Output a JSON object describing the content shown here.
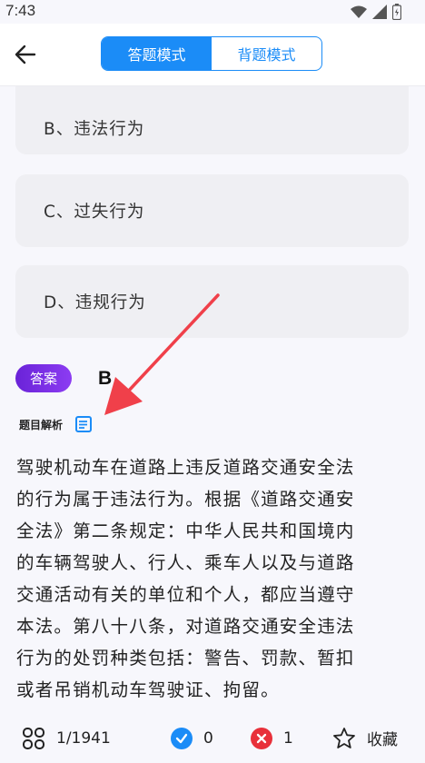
{
  "status": {
    "time": "7:43"
  },
  "header": {
    "tabs": [
      {
        "label": "答题模式",
        "active": true
      },
      {
        "label": "背题模式",
        "active": false
      }
    ]
  },
  "options": [
    {
      "label": "B、违法行为"
    },
    {
      "label": "C、过失行为"
    },
    {
      "label": "D、违规行为"
    }
  ],
  "answer": {
    "badge": "答案",
    "value": "B"
  },
  "analysis": {
    "title": "题目解析",
    "lines": [
      "驾驶机动车在道路上违反道路交通安全法",
      "的行为属于违法行为。根据《道路交通安",
      "全法》第二条规定：中华人民共和国境内",
      "的车辆驾驶人、行人、乘车人以及与道路",
      "交通活动有关的单位和个人，都应当遵守",
      "本法。第八十八条，对道路交通安全违法",
      "行为的处罚种类包括：警告、罚款、暂扣",
      "或者吊销机动车驾驶证、拘留。"
    ]
  },
  "bottom": {
    "progress": "1/1941",
    "correct": "0",
    "wrong": "1",
    "favorite_label": "收藏"
  },
  "colors": {
    "accent": "#1b8cf7",
    "badge": "#7a2fe6",
    "wrong": "#e8303a",
    "arrow": "#f0404a"
  }
}
